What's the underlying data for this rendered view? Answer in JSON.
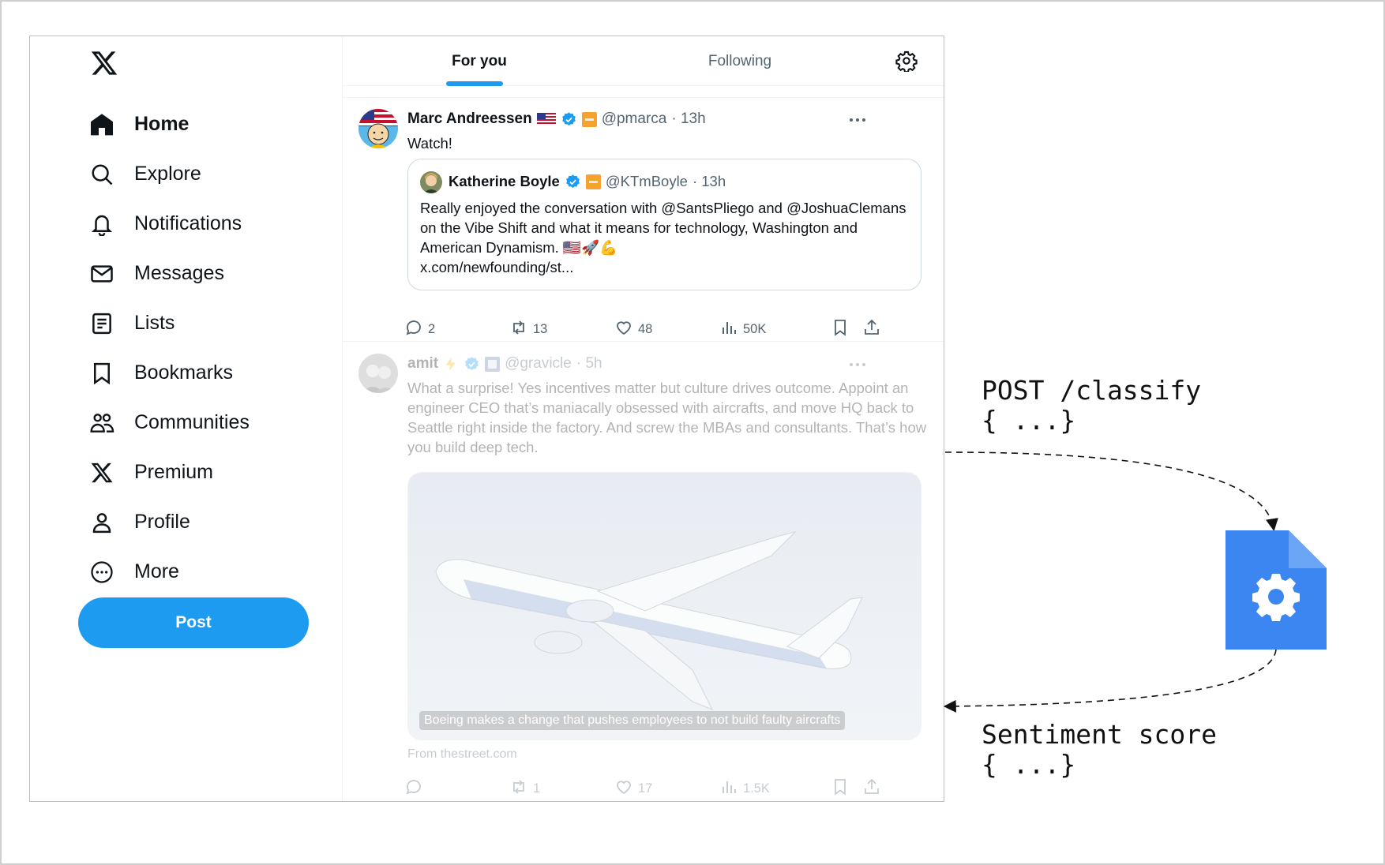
{
  "sidebar": {
    "items": [
      {
        "label": "Home",
        "icon": "home-icon",
        "active": true
      },
      {
        "label": "Explore",
        "icon": "search-icon"
      },
      {
        "label": "Notifications",
        "icon": "bell-icon"
      },
      {
        "label": "Messages",
        "icon": "envelope-icon"
      },
      {
        "label": "Lists",
        "icon": "list-icon"
      },
      {
        "label": "Bookmarks",
        "icon": "bookmark-icon"
      },
      {
        "label": "Communities",
        "icon": "communities-icon"
      },
      {
        "label": "Premium",
        "icon": "x-logo-icon"
      },
      {
        "label": "Profile",
        "icon": "person-icon"
      },
      {
        "label": "More",
        "icon": "more-circle-icon"
      }
    ],
    "post_label": "Post"
  },
  "tabs": {
    "for_you": "For you",
    "following": "Following"
  },
  "tweet1": {
    "name": "Marc Andreessen",
    "handle": "@pmarca",
    "time": "· 13h",
    "text": "Watch!",
    "quote": {
      "name": "Katherine Boyle",
      "handle": "@KTmBoyle",
      "time": "· 13h",
      "text": "Really enjoyed the conversation with @SantsPliego and @JoshuaClemans on the Vibe Shift and what it means for technology, Washington and American Dynamism. 🇺🇸🚀💪",
      "link": "x.com/newfounding/st..."
    },
    "stats": {
      "replies": "2",
      "reposts": "13",
      "likes": "48",
      "views": "50K"
    }
  },
  "tweet2": {
    "name": "amit",
    "handle": "@gravicle",
    "time": "· 5h",
    "text": "What a surprise! Yes incentives matter but culture drives outcome. Appoint an engineer CEO that’s maniacally obsessed with aircrafts, and move HQ back to Seattle right inside the factory. And screw the MBAs and consultants. That’s how you build deep tech.",
    "media_caption": "Boeing makes a change that pushes employees to not build faulty aircrafts",
    "source": "From thestreet.com",
    "stats": {
      "replies": "",
      "reposts": "1",
      "likes": "17",
      "views": "1.5K"
    }
  },
  "diagram": {
    "request_line1": "POST /classify",
    "request_line2": "{ ...}",
    "response_line1": "Sentiment score",
    "response_line2": "{ ...}"
  },
  "colors": {
    "accent": "#1d9bf0",
    "file_icon": "#3b86f0",
    "file_icon_fold": "#2a5fb8"
  }
}
